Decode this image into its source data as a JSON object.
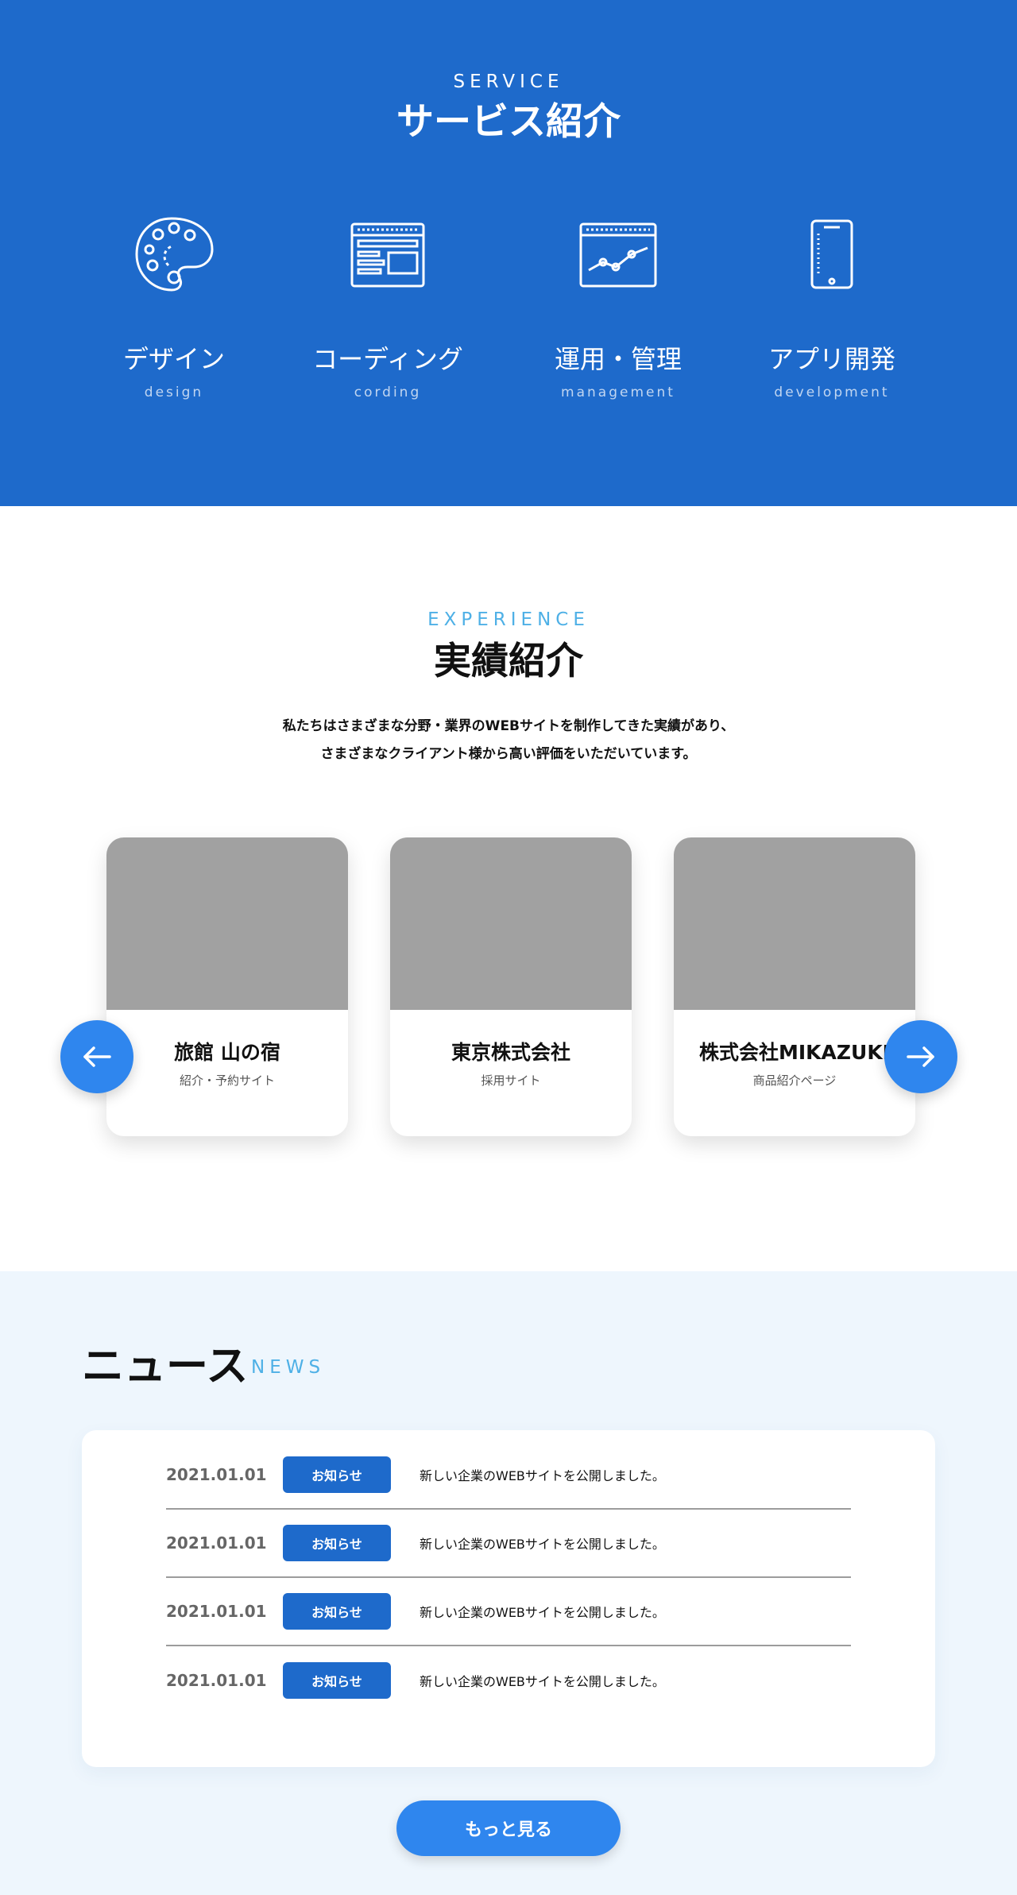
{
  "service": {
    "eyebrow": "SERVICE",
    "title": "サービス紹介",
    "items": [
      {
        "icon": "palette-icon",
        "label": "デザイン",
        "sub": "design"
      },
      {
        "icon": "web-layout-icon",
        "label": "コーディング",
        "sub": "cording"
      },
      {
        "icon": "analytics-chart-icon",
        "label": "運用・管理",
        "sub": "management"
      },
      {
        "icon": "smartphone-icon",
        "label": "アプリ開発",
        "sub": "development"
      }
    ]
  },
  "experience": {
    "eyebrow": "EXPERIENCE",
    "title": "実績紹介",
    "lead_line1": "私たちはさまざまな分野・業界のWEBサイトを制作してきた実績があり、",
    "lead_line2": "さまざまなクライアント様から高い評価をいただいています。",
    "cards": [
      {
        "name": "旅館 山の宿",
        "desc": "紹介・予約サイト"
      },
      {
        "name": "東京株式会社",
        "desc": "採用サイト"
      },
      {
        "name": "株式会社MIKAZUKI",
        "desc": "商品紹介ページ"
      }
    ],
    "prev_icon": "arrow-left-icon",
    "next_icon": "arrow-right-icon"
  },
  "news": {
    "title": "ニュース",
    "eyebrow": "NEWS",
    "items": [
      {
        "date": "2021.01.01",
        "tag": "お知らせ",
        "text": "新しい企業のWEBサイトを公開しました。"
      },
      {
        "date": "2021.01.01",
        "tag": "お知らせ",
        "text": "新しい企業のWEBサイトを公開しました。"
      },
      {
        "date": "2021.01.01",
        "tag": "お知らせ",
        "text": "新しい企業のWEBサイトを公開しました。"
      },
      {
        "date": "2021.01.01",
        "tag": "お知らせ",
        "text": "新しい企業のWEBサイトを公開しました。"
      }
    ],
    "more_label": "もっと見る"
  },
  "colors": {
    "service_bg": "#1e6acb",
    "accent_button": "#2f86ee",
    "eyebrow_light": "#4eb0e6",
    "news_bg": "#eef6fd"
  }
}
